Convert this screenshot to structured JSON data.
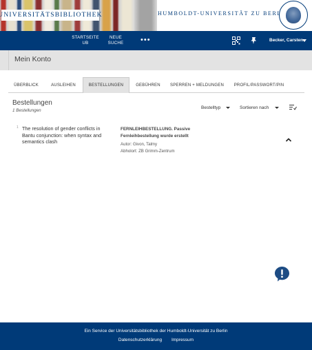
{
  "banner": {
    "library_name": "UNIVERSITÄTSBIBLIOTHEK",
    "university_name": "HUMBOLDT-UNIVERSITÄT ZU BERLIN",
    "book_colors": [
      "#b5332a",
      "#e8e1cf",
      "#2d4d7a",
      "#d9c46b",
      "#8b2f2f",
      "#f1ece0",
      "#5a7b4a",
      "#c8b48a",
      "#9e3b3b",
      "#efe9d8",
      "#41546f",
      "#d8a24a",
      "#7c2626",
      "#ece6d4",
      "#a3a3a3"
    ],
    "accent_color": "#003a78"
  },
  "nav": {
    "items": [
      {
        "label": "STARTSEITE UB"
      },
      {
        "label": "NEUE SUCHE"
      }
    ],
    "more_icon": "ellipsis-icon",
    "qr_icon": "qr-code-icon",
    "bookmark_icon": "pin-icon",
    "user": "Becker, Carsten"
  },
  "konto": {
    "title": "Mein Konto"
  },
  "tabs": [
    {
      "label": "ÜBERBLICK",
      "active": false
    },
    {
      "label": "AUSLEIHEN",
      "active": false
    },
    {
      "label": "BESTELLUNGEN",
      "active": true
    },
    {
      "label": "GEBÜHREN",
      "active": false
    },
    {
      "label": "SPERREN + MELDUNGEN",
      "active": false
    },
    {
      "label": "PROFIL/PASSWORT/PIN",
      "active": false
    }
  ],
  "section": {
    "title": "Bestellungen",
    "count": "1 Bestellungen",
    "filter_label": "Bestelltyp",
    "sort_label": "Sortieren nach"
  },
  "orders": [
    {
      "index": "1",
      "title": "The resolution of gender conflicts in Bantu conjunction: when syntax and semantics clash",
      "status": "FERNLEIHBESTELLUNG. Passive Fernleihbestellung wurde erstellt",
      "author": "Autor: Givon, Talmy",
      "pickup": "Abholort: ZB Grimm-Zentrum"
    }
  ],
  "footer": {
    "service_text": "Ein Service der Universitätsbibliothek der Humboldt-Universität zu Berlin",
    "links": [
      "Datenschutzerklärung",
      "Impressum"
    ]
  }
}
